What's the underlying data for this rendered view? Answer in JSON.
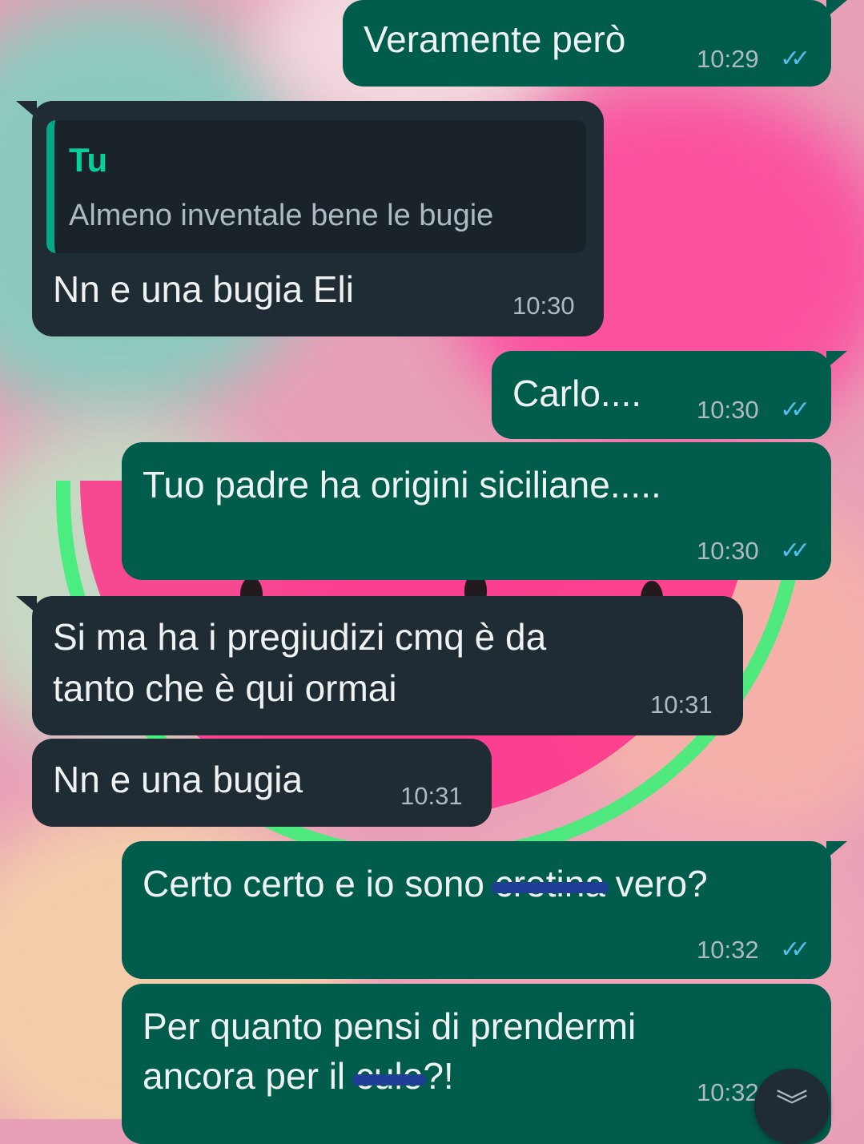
{
  "theme": {
    "outgoing_bubble": "#005c4b",
    "incoming_bubble": "#202c33",
    "read_ticks": "#53bdeb",
    "quote_accent": "#06cf9c"
  },
  "messages": [
    {
      "direction": "outgoing",
      "text": "Veramente però",
      "time": "10:29",
      "ticks": "read-double-check-icon"
    },
    {
      "direction": "incoming",
      "reply_to": {
        "author": "Tu",
        "text": "Almeno inventale bene le bugie"
      },
      "text": "Nn e una bugia Eli",
      "time": "10:30"
    },
    {
      "direction": "outgoing",
      "text": "Carlo....",
      "time": "10:30",
      "ticks": "read-double-check-icon"
    },
    {
      "direction": "outgoing",
      "text": "Tuo padre ha origini siciliane.....",
      "time": "10:30",
      "ticks": "read-double-check-icon"
    },
    {
      "direction": "incoming",
      "lines": [
        "Si ma ha i pregiudizi cmq è da",
        "tanto che è qui ormai"
      ],
      "time": "10:31"
    },
    {
      "direction": "incoming",
      "text": "Nn e una bugia",
      "time": "10:31"
    },
    {
      "direction": "outgoing",
      "text_before": "Certo certo e io sono ",
      "censored": "cretina",
      "text_after": " vero?",
      "time": "10:32",
      "ticks": "read-double-check-icon"
    },
    {
      "direction": "outgoing",
      "line1": "Per quanto pensi di prendermi",
      "line2_before": "ancora per il ",
      "line2_censored": "culo",
      "line2_after": "?!",
      "time": "10:32"
    }
  ],
  "tick_glyph": "✓✓",
  "scroll_down_glyph": "︾"
}
